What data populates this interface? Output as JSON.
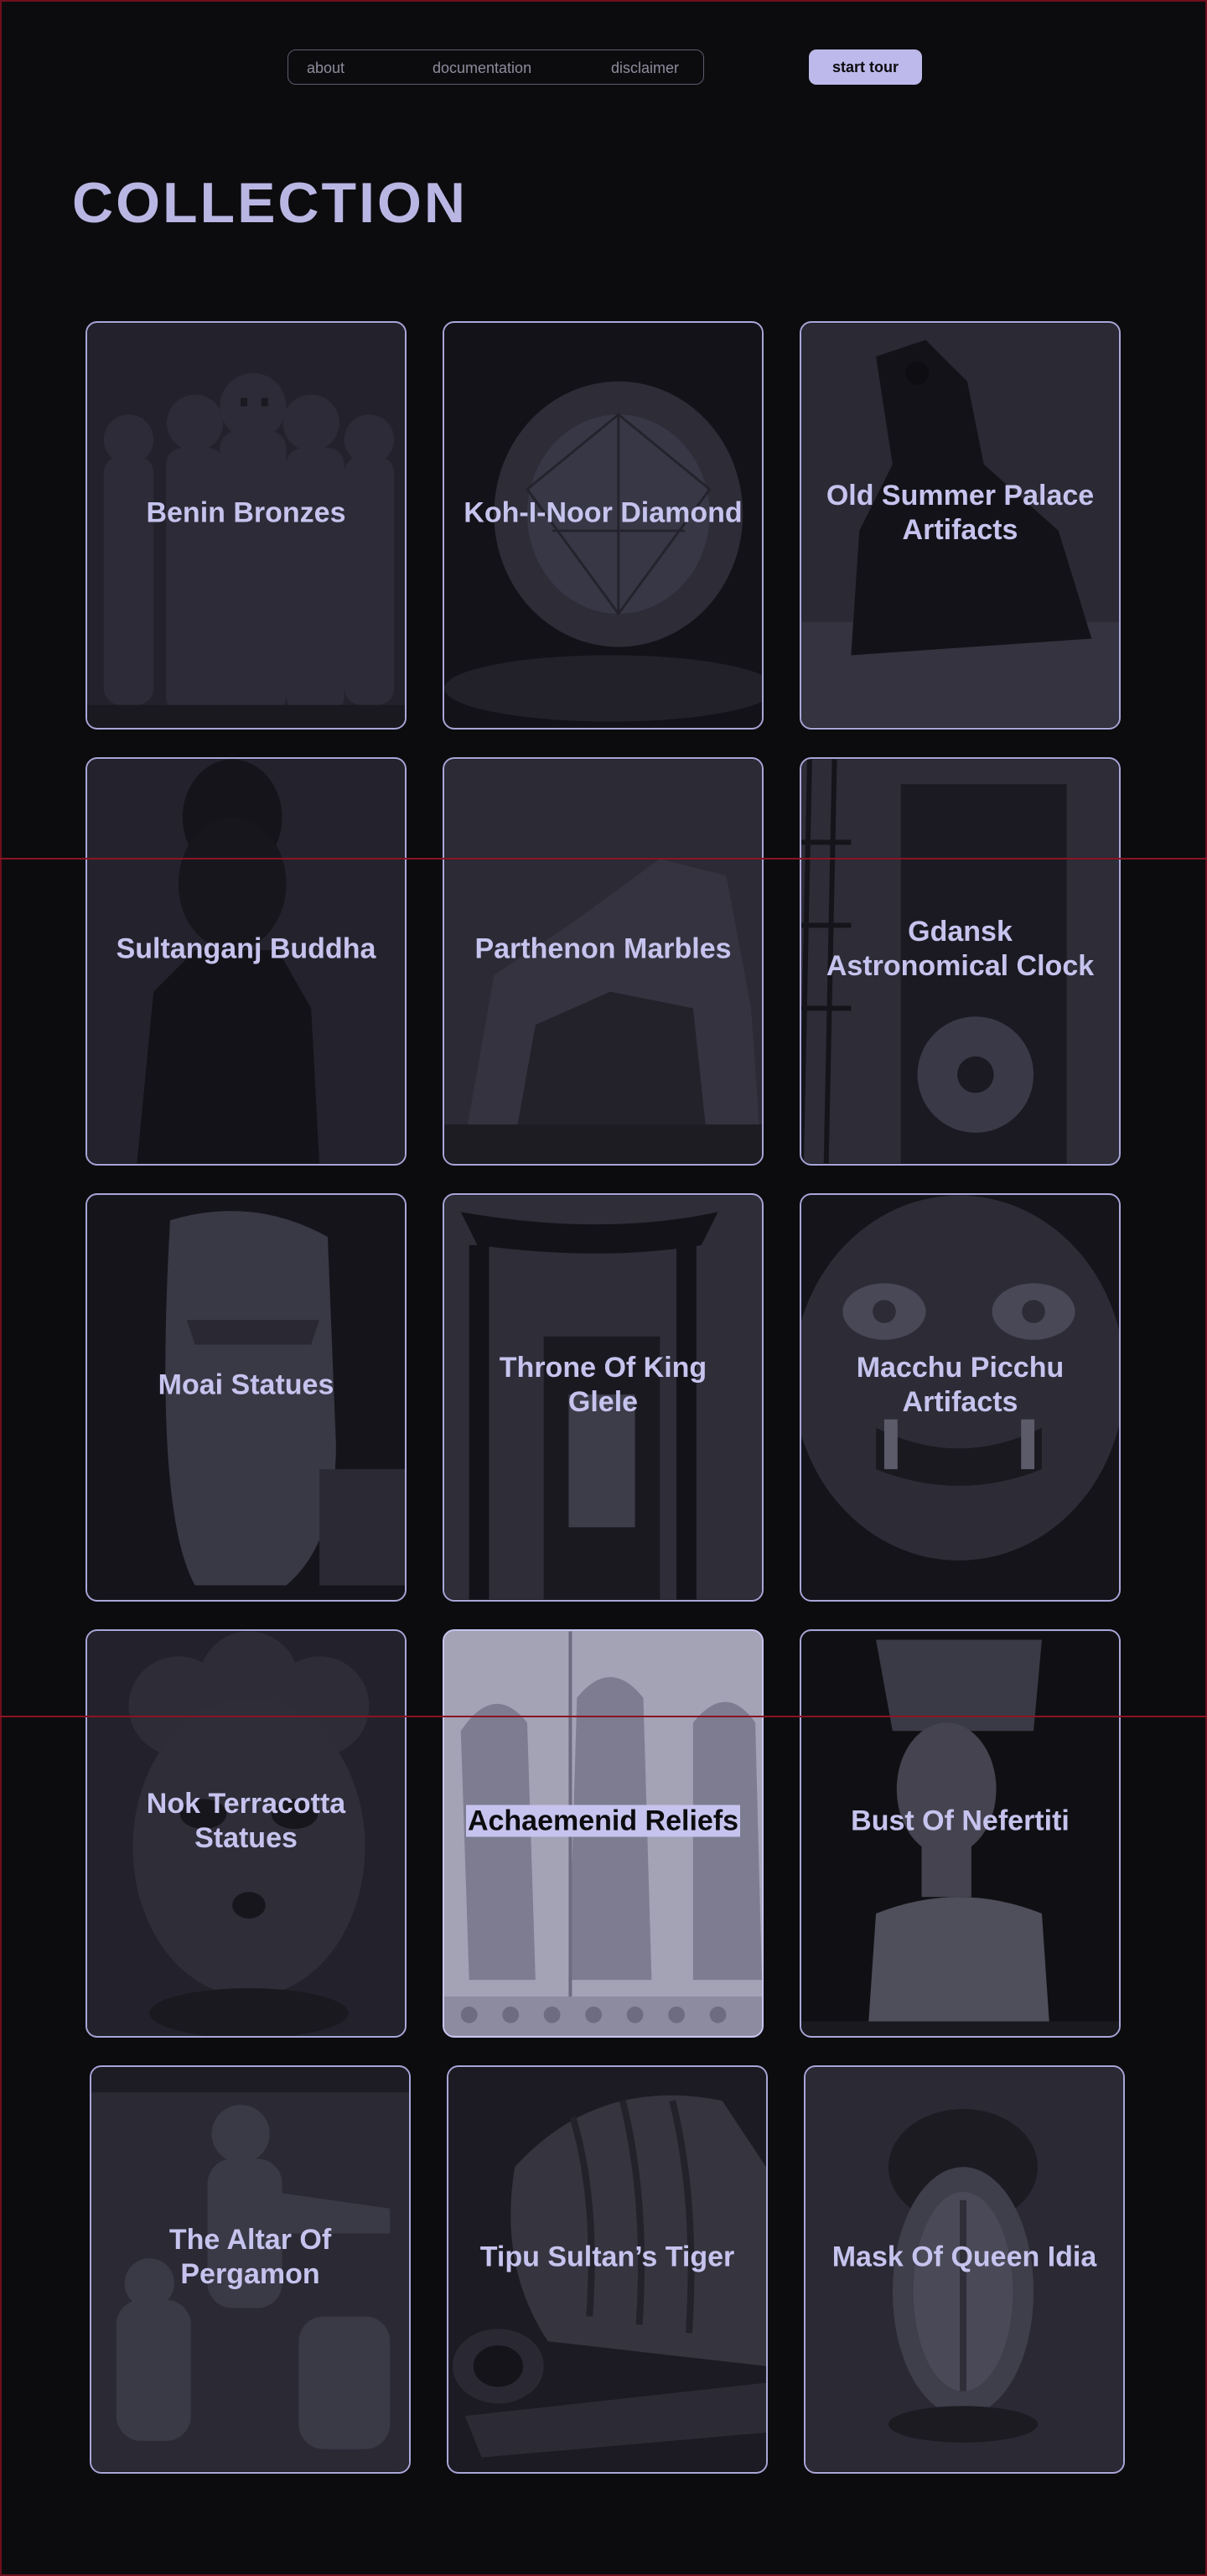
{
  "nav": {
    "links": [
      "about",
      "documentation",
      "disclaimer"
    ],
    "cta": "start tour"
  },
  "heading": "COLLECTION",
  "items": [
    {
      "label": "Benin Bronzes"
    },
    {
      "label": "Koh-I-Noor Diamond"
    },
    {
      "label": "Old Summer Palace Artifacts"
    },
    {
      "label": "Sultanganj Buddha"
    },
    {
      "label": "Parthenon Marbles"
    },
    {
      "label": "Gdansk Astronomical Clock"
    },
    {
      "label": "Moai Statues"
    },
    {
      "label": "Throne Of King Glele"
    },
    {
      "label": "Macchu Picchu Artifacts"
    },
    {
      "label": "Nok Terracotta Statues"
    },
    {
      "label": "Achaemenid Reliefs"
    },
    {
      "label": "Bust Of Nefertiti"
    },
    {
      "label": "The Altar Of Pergamon"
    },
    {
      "label": "Tipu Sultan’s Tiger"
    },
    {
      "label": "Mask Of Queen Idia"
    }
  ],
  "colors": {
    "background": "#0c0c0f",
    "accent": "#bdb9ea",
    "card_border": "#a9a6d8",
    "guide_line": "#8a1422"
  }
}
